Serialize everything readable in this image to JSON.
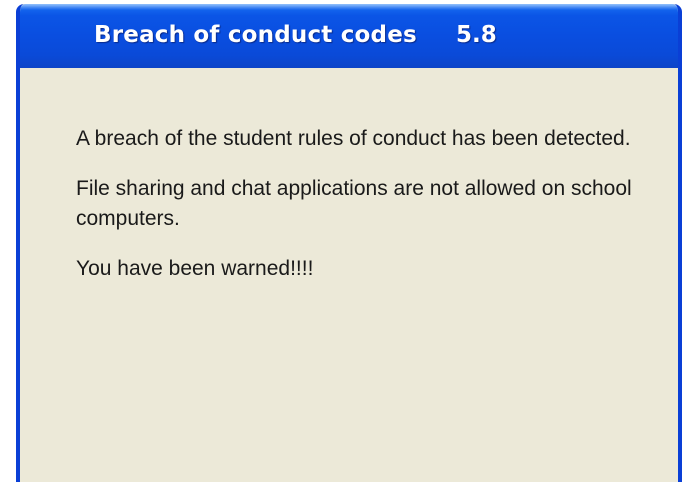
{
  "window": {
    "title": "Breach of conduct codes",
    "version": "5.8"
  },
  "message": {
    "paragraphs": [
      "A breach of the student rules of conduct has been detected.",
      "File sharing and chat applications are not allowed on school computers.",
      "You have been warned!!!!"
    ]
  },
  "colors": {
    "titlebar": "#0a4ee0",
    "window_border": "#0a3fd6",
    "background": "#ece9d8",
    "text": "#1a1a1a"
  }
}
